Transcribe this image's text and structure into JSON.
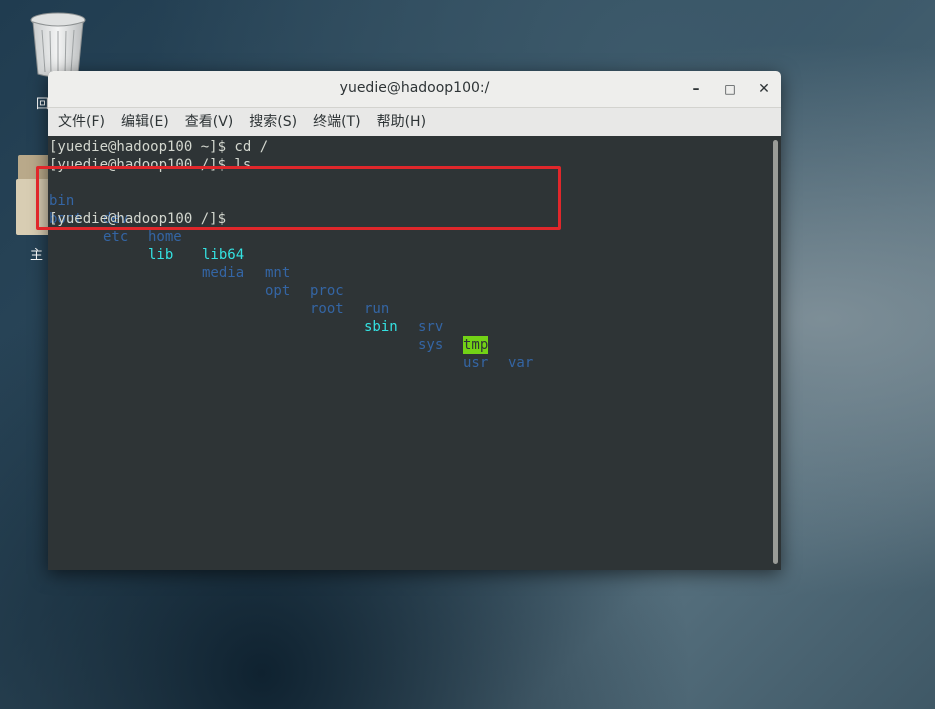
{
  "desktop": {
    "trash_label": "回",
    "home_label": "主"
  },
  "window": {
    "title": "yuedie@hadoop100:/",
    "minimize": "–",
    "maximize": "□",
    "close": "✕"
  },
  "menu": [
    "文件(F)",
    "编辑(E)",
    "查看(V)",
    "搜索(S)",
    "终端(T)",
    "帮助(H)"
  ],
  "terminal": {
    "line1": "[yuedie@hadoop100 ~]$ cd /",
    "line2": "[yuedie@hadoop100 /]$ ls",
    "row1": [
      "bin",
      "dev",
      "home",
      "lib64",
      "mnt",
      "proc",
      "run",
      "srv",
      "tmp",
      "var"
    ],
    "row2": [
      "boot",
      "etc",
      "lib",
      "media",
      "opt",
      "root",
      "sbin",
      "sys",
      "usr"
    ],
    "line5": "[yuedie@hadoop100 /]$ "
  },
  "colors": {
    "directory": "#3465a4",
    "symlink": "#34e2e2",
    "sticky_bg": "#73d216",
    "highlight_box": "#e0272b"
  }
}
